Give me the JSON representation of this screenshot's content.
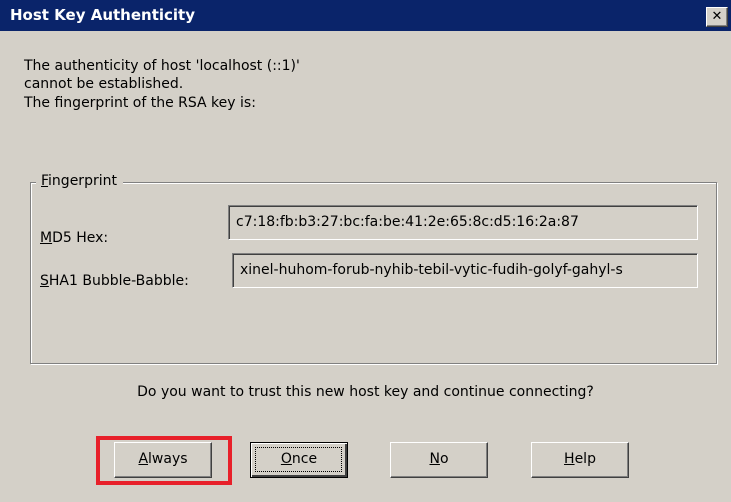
{
  "window": {
    "title": "Host Key Authenticity",
    "close_glyph": "✕"
  },
  "message": {
    "line1": "The authenticity of host 'localhost (::1)'",
    "line2": "cannot be established.",
    "line3": "The fingerprint of the RSA key is:"
  },
  "fingerprint_group": {
    "legend_hotkey": "F",
    "legend_rest": "ingerprint",
    "md5": {
      "label_hotkey": "M",
      "label_rest": "D5 Hex:",
      "value": "c7:18:fb:b3:27:bc:fa:be:41:2e:65:8c:d5:16:2a:87"
    },
    "sha1": {
      "label_hotkey": "S",
      "label_rest": "HA1 Bubble-Babble:",
      "value": "xinel-huhom-forub-nyhib-tebil-vytic-fudih-golyf-gahyl-s"
    }
  },
  "question": "Do you want to trust this new host key and continue connecting?",
  "buttons": {
    "always": {
      "hotkey": "A",
      "rest": "lways"
    },
    "once": {
      "hotkey": "O",
      "rest": "nce"
    },
    "no": {
      "hotkey": "N",
      "rest": "o"
    },
    "help": {
      "hotkey": "H",
      "rest": "elp"
    }
  },
  "colors": {
    "titlebar": "#0a246a",
    "dialog_bg": "#d4d0c8",
    "highlight": "#e8202a"
  }
}
